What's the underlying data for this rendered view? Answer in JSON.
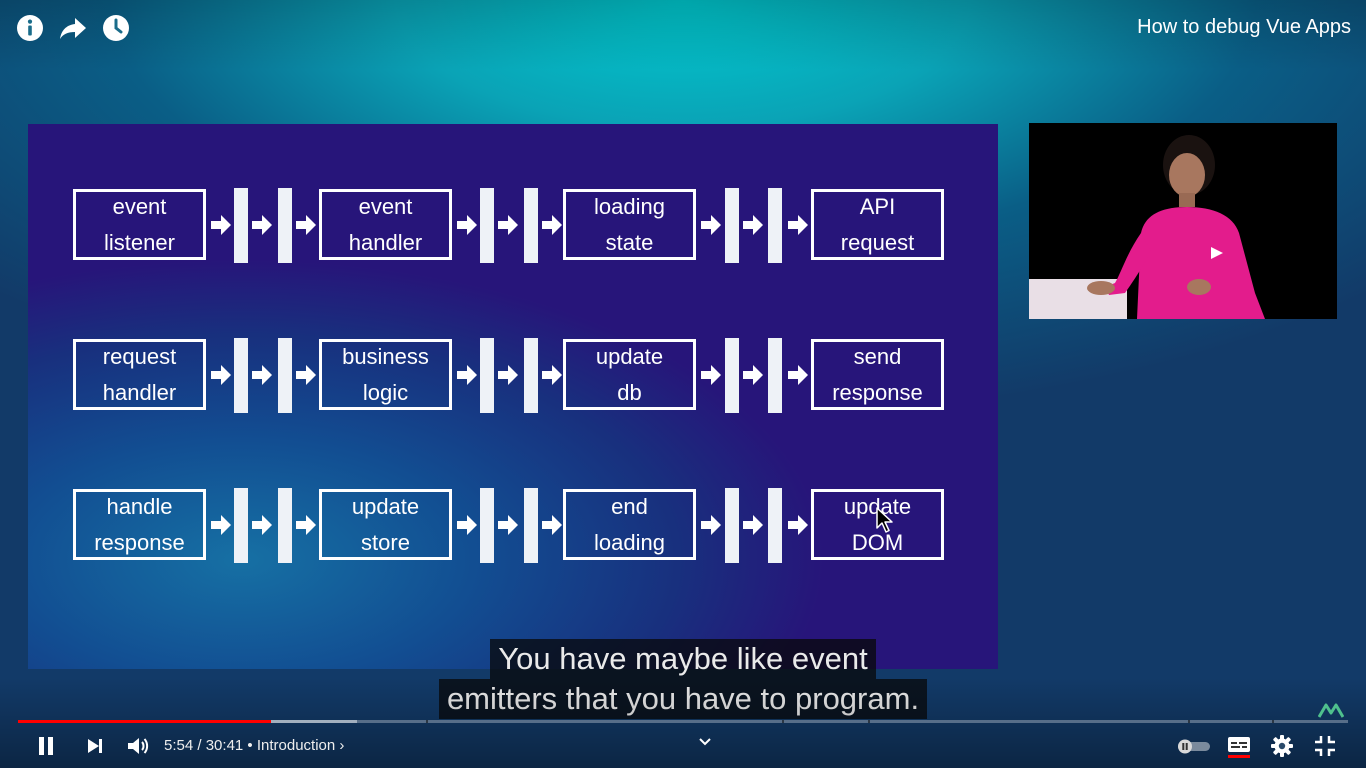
{
  "video": {
    "title": "How to debug Vue Apps"
  },
  "top_controls": {
    "info": "info-icon",
    "share": "share-icon",
    "watch_later": "clock-icon"
  },
  "slide": {
    "rows": [
      [
        "event\nlistener",
        "event\nhandler",
        "loading\nstate",
        "API\nrequest"
      ],
      [
        "request\nhandler",
        "business\nlogic",
        "update\ndb",
        "send\nresponse"
      ],
      [
        "handle\nresponse",
        "update\nstore",
        "end\nloading",
        "update\nDOM"
      ]
    ]
  },
  "captions": {
    "line1": "You have maybe like event",
    "line2": "emitters that you have to program."
  },
  "player": {
    "time_current": "5:54",
    "time_total": "30:41",
    "time_sep": " / ",
    "chapter_sep": " • ",
    "chapter": "Introduction",
    "chapter_chevron": "›",
    "progress_played": 0.19,
    "progress_buffered": 0.255,
    "accent_color": "#ff0000"
  }
}
